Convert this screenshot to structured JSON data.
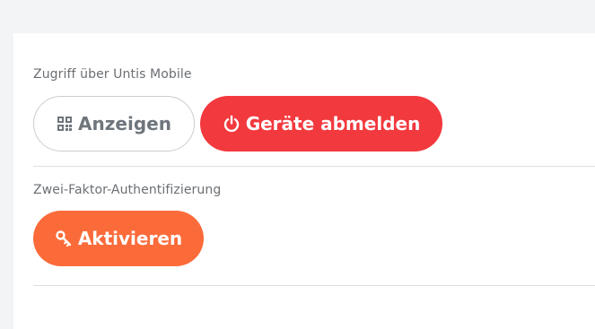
{
  "access_section": {
    "label": "Zugriff über Untis Mobile",
    "show_button": {
      "label": "Anzeigen",
      "icon": "qr-code-icon"
    },
    "logout_devices_button": {
      "label": "Geräte abmelden",
      "icon": "power-icon"
    }
  },
  "two_factor_section": {
    "label": "Zwei-Faktor-Authentifizierung",
    "activate_button": {
      "label": "Aktivieren",
      "icon": "key-icon"
    }
  },
  "colors": {
    "danger": "#f2393e",
    "accent": "#fb6b3a",
    "outline_text": "#6e757c"
  }
}
